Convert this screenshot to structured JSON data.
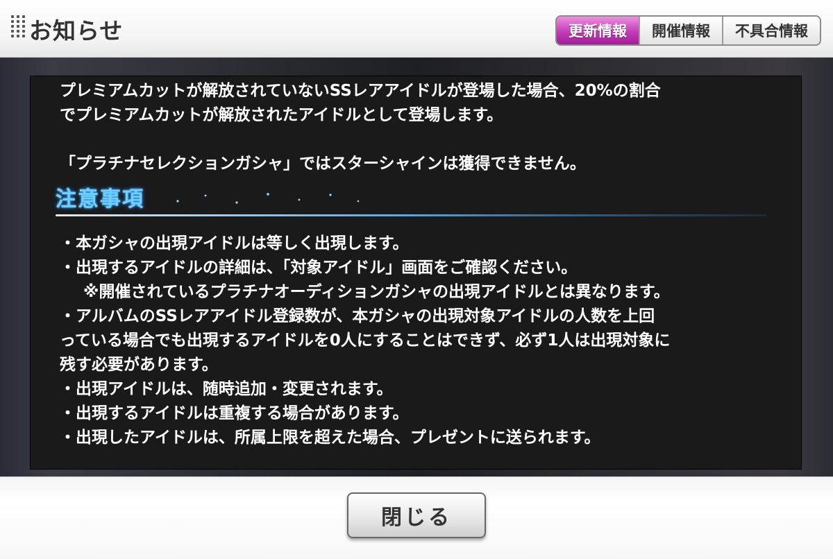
{
  "header": {
    "title": "お知らせ",
    "tabs": [
      {
        "label": "更新情報",
        "active": true
      },
      {
        "label": "開催情報",
        "active": false
      },
      {
        "label": "不具合情報",
        "active": false
      }
    ]
  },
  "content": {
    "paragraph1_line1": "プレミアムカットが解放されていないSSレアアイドルが登場した場合、20%の割合",
    "paragraph1_line2": "でプレミアムカットが解放されたアイドルとして登場します。",
    "paragraph2": "「プラチナセレクションガシャ」ではスターシャインは獲得できません。",
    "section_title": "注意事項",
    "notes": [
      "・本ガシャの出現アイドルは等しく出現します。",
      "・出現するアイドルの詳細は、「対象アイドル」画面をご確認ください。",
      "※開催されているプラチナオーディションガシャの出現アイドルとは異なります。",
      "・アルバムのSSレアアイドル登録数が、本ガシャの出現対象アイドルの人数を上回",
      "っている場合でも出現するアイドルを0人にすることはできず、必ず1人は出現対象に",
      "残す必要があります。",
      "・出現アイドルは、随時追加・変更されます。",
      "・出現するアイドルは重複する場合があります。",
      "・出現したアイドルは、所属上限を超えた場合、プレゼントに送られます。"
    ]
  },
  "footer": {
    "close_label": "閉じる"
  },
  "colors": {
    "active_tab": "#c23bb6",
    "section_title": "#6fd0ff",
    "panel_bg": "#1a1a1a"
  }
}
